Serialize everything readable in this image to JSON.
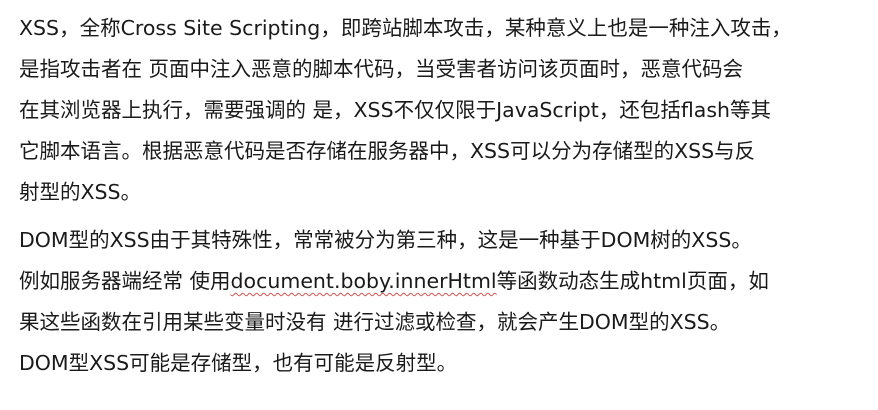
{
  "paragraphs": [
    {
      "lines": [
        "XSS，全称Cross Site Scripting，即跨站脚本攻击，某种意义上也是一种注入攻击，",
        "是指攻击者在 页面中注入恶意的脚本代码，当受害者访问该页面时，恶意代码会",
        "在其浏览器上执行，需要强调的 是，XSS不仅仅限于JavaScript，还包括flash等其",
        "它脚本语言。根据恶意代码是否存储在服务器中，XSS可以分为存储型的XSS与反",
        "射型的XSS。"
      ]
    },
    {
      "line1": "DOM型的XSS由于其特殊性，常常被分为第三种，这是一种基于DOM树的XSS。",
      "line2_before": "例如服务器端经常 使用",
      "line2_code": "document.boby.innerHtml",
      "line2_after": "等函数动态生成html页面，如",
      "line3": "果这些函数在引用某些变量时没有 进行过滤或检查，就会产生DOM型的XSS。",
      "line4": "DOM型XSS可能是存储型，也有可能是反射型。"
    }
  ]
}
